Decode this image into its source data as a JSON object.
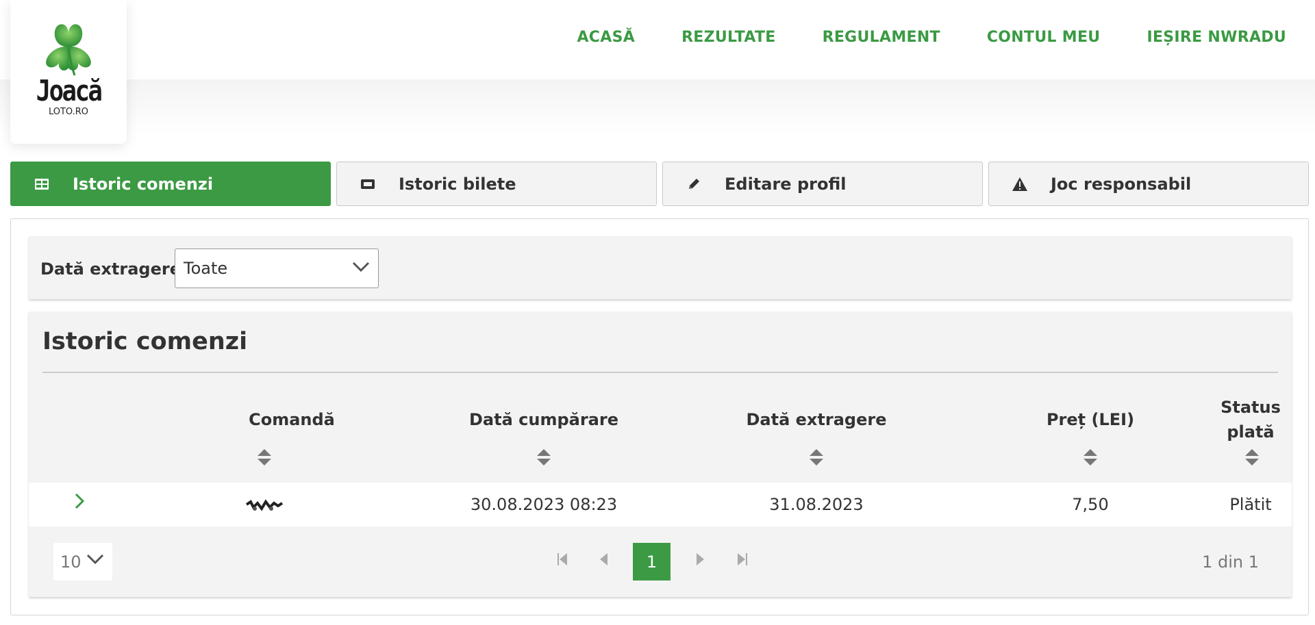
{
  "brand": {
    "logo_word": "Joacă",
    "logo_sub": "LOTO.RO",
    "accent": "#3b9a43"
  },
  "nav": [
    "ACASĂ",
    "REZULTATE",
    "REGULAMENT",
    "CONTUL MEU",
    "IEȘIRE NWRADU"
  ],
  "tabs": [
    {
      "label": "Istoric comenzi",
      "icon": "table-icon",
      "active": true
    },
    {
      "label": "Istoric bilete",
      "icon": "ticket-icon",
      "active": false
    },
    {
      "label": "Editare profil",
      "icon": "pencil-icon",
      "active": false
    },
    {
      "label": "Joc responsabil",
      "icon": "warning-icon",
      "active": false
    }
  ],
  "filter": {
    "label": "Dată extragere:",
    "selected": "Toate"
  },
  "orders": {
    "title": "Istoric comenzi",
    "columns": [
      "Comandă",
      "Dată cumpărare",
      "Dată extragere",
      "Preț (LEI)",
      "Status plată"
    ],
    "rows": [
      {
        "order": "",
        "purchase_date": "30.08.2023 08:23",
        "draw_date": "31.08.2023",
        "price": "7,50",
        "status": "Plătit"
      }
    ]
  },
  "pagination": {
    "page_size": "10",
    "current_page": "1",
    "info": "1 din 1"
  }
}
